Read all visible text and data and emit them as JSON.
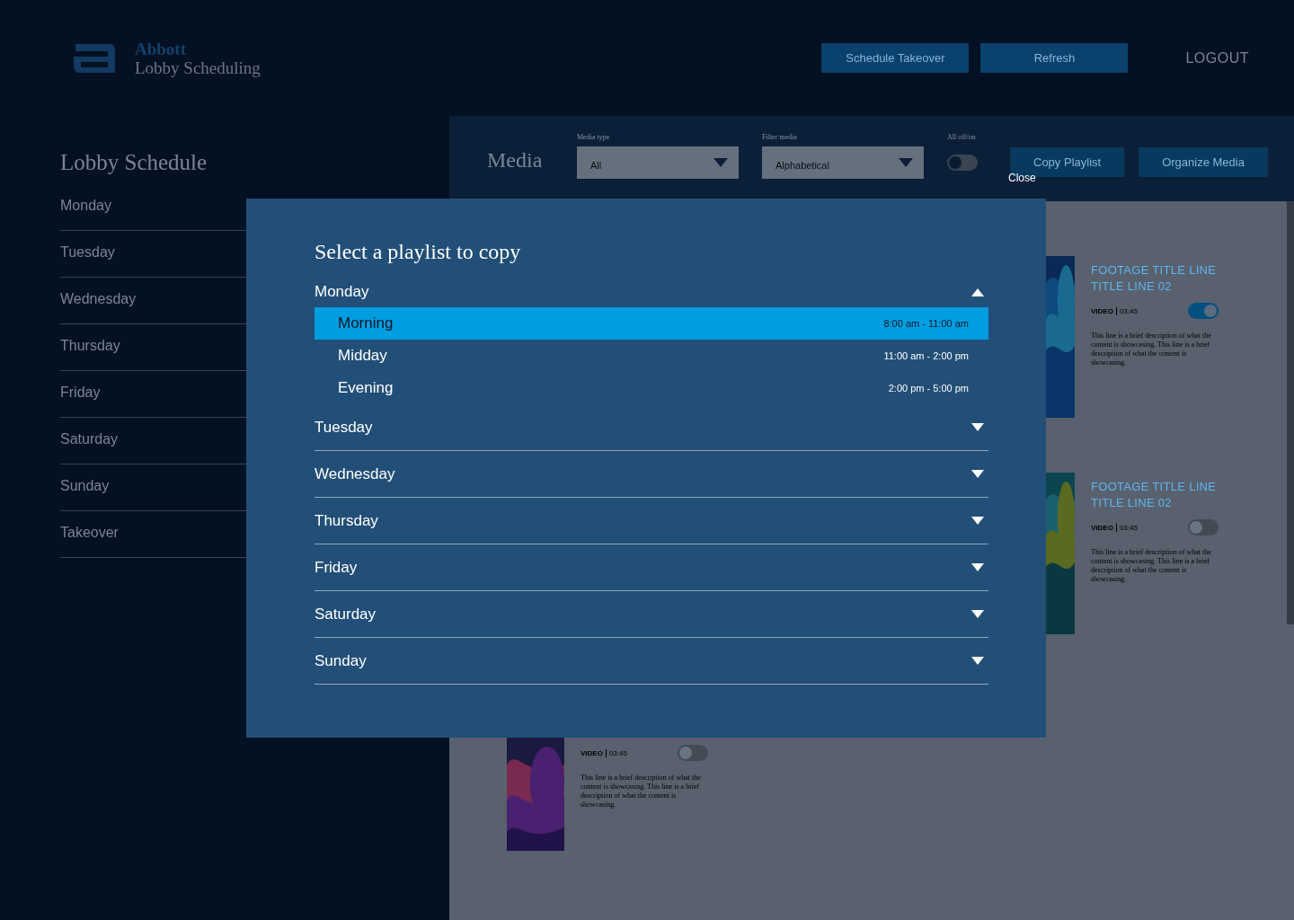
{
  "header": {
    "brand": "Abbott",
    "app_name": "Lobby Scheduling",
    "buttons": [
      "Schedule Takeover",
      "Refresh"
    ],
    "logout": "LOGOUT"
  },
  "sidebar": {
    "title": "Lobby Schedule",
    "items": [
      {
        "label": "Monday"
      },
      {
        "label": "Tuesday"
      },
      {
        "label": "Wednesday"
      },
      {
        "label": "Thursday"
      },
      {
        "label": "Friday"
      },
      {
        "label": "Saturday"
      },
      {
        "label": "Sunday"
      },
      {
        "label": "Takeover"
      }
    ]
  },
  "media": {
    "title": "Media",
    "filters": [
      {
        "label": "Media type",
        "value": "All"
      },
      {
        "label": "Filter media",
        "value": "Alphabetical"
      }
    ],
    "all_toggle": {
      "label": "All off/on",
      "on": false
    },
    "buttons": [
      "Copy Playlist",
      "Organize Media"
    ],
    "cards": [
      {
        "title": "FOOTAGE TITLE LINE TITLE LINE 02",
        "type": "VIDEO",
        "duration": "03:45",
        "on": true,
        "description": "This line is a brief description of what the content is showcasing. This line is a brief description of what the content is showcasing."
      },
      {
        "title": "FOOTAGE TITLE LINE TITLE LINE 02",
        "type": "VIDEO",
        "duration": "03:45",
        "on": false,
        "description": "This line is a brief description of what the content is showcasing. This line is a brief description of what the content is showcasing."
      },
      {
        "type": "VIDEO",
        "duration": "03:45",
        "on": false,
        "description": "This line is a brief description of what the content is showcasing. This line is a brief description of what the content is showcasing."
      }
    ]
  },
  "dialog": {
    "close": "Close",
    "title": "Select a playlist to copy",
    "days": [
      {
        "label": "Monday",
        "expanded": true,
        "playlists": [
          {
            "name": "Morning",
            "time": "8:00 am - 11:00 am",
            "selected": true
          },
          {
            "name": "Midday",
            "time": "11:00 am - 2:00 pm",
            "selected": false
          },
          {
            "name": "Evening",
            "time": "2:00 pm - 5:00 pm",
            "selected": false
          }
        ]
      },
      {
        "label": "Tuesday",
        "expanded": false
      },
      {
        "label": "Wednesday",
        "expanded": false
      },
      {
        "label": "Thursday",
        "expanded": false
      },
      {
        "label": "Friday",
        "expanded": false
      },
      {
        "label": "Saturday",
        "expanded": false
      },
      {
        "label": "Sunday",
        "expanded": false
      }
    ]
  }
}
